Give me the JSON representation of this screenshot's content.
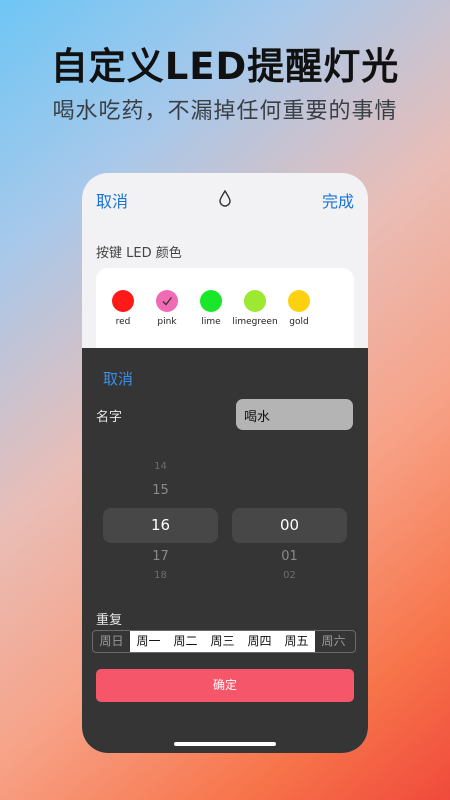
{
  "promo": {
    "headline": "自定义LED提醒灯光",
    "subline": "喝水吃药，不漏掉任何重要的事情"
  },
  "topbar": {
    "cancel_label": "取消",
    "done_label": "完成",
    "icon": "water-drop-icon"
  },
  "color_section": {
    "label": "按键 LED 颜色",
    "selected": "pink",
    "options": [
      {
        "name": "red",
        "color": "#ff1a1a"
      },
      {
        "name": "pink",
        "color": "#f06ab4"
      },
      {
        "name": "lime",
        "color": "#19e82a"
      },
      {
        "name": "limegreen",
        "color": "#9de832"
      },
      {
        "name": "gold",
        "color": "#fdd10f"
      }
    ]
  },
  "sheet": {
    "cancel_label": "取消",
    "name_label": "名字",
    "name_value": "喝水",
    "hour_picker": {
      "above2": "14",
      "above1": "15",
      "selected": "16",
      "below1": "17",
      "below2": "18"
    },
    "minute_picker": {
      "selected": "00",
      "below1": "01",
      "below2": "02"
    },
    "repeat_label": "重复",
    "days": [
      {
        "label": "周日",
        "active": false
      },
      {
        "label": "周一",
        "active": true
      },
      {
        "label": "周二",
        "active": true
      },
      {
        "label": "周三",
        "active": true
      },
      {
        "label": "周四",
        "active": true
      },
      {
        "label": "周五",
        "active": true
      },
      {
        "label": "周六",
        "active": false
      }
    ],
    "confirm_label": "确定"
  },
  "colors": {
    "accent_blue": "#1a73d9",
    "confirm_red": "#f5566a",
    "sheet_bg": "#353535"
  }
}
